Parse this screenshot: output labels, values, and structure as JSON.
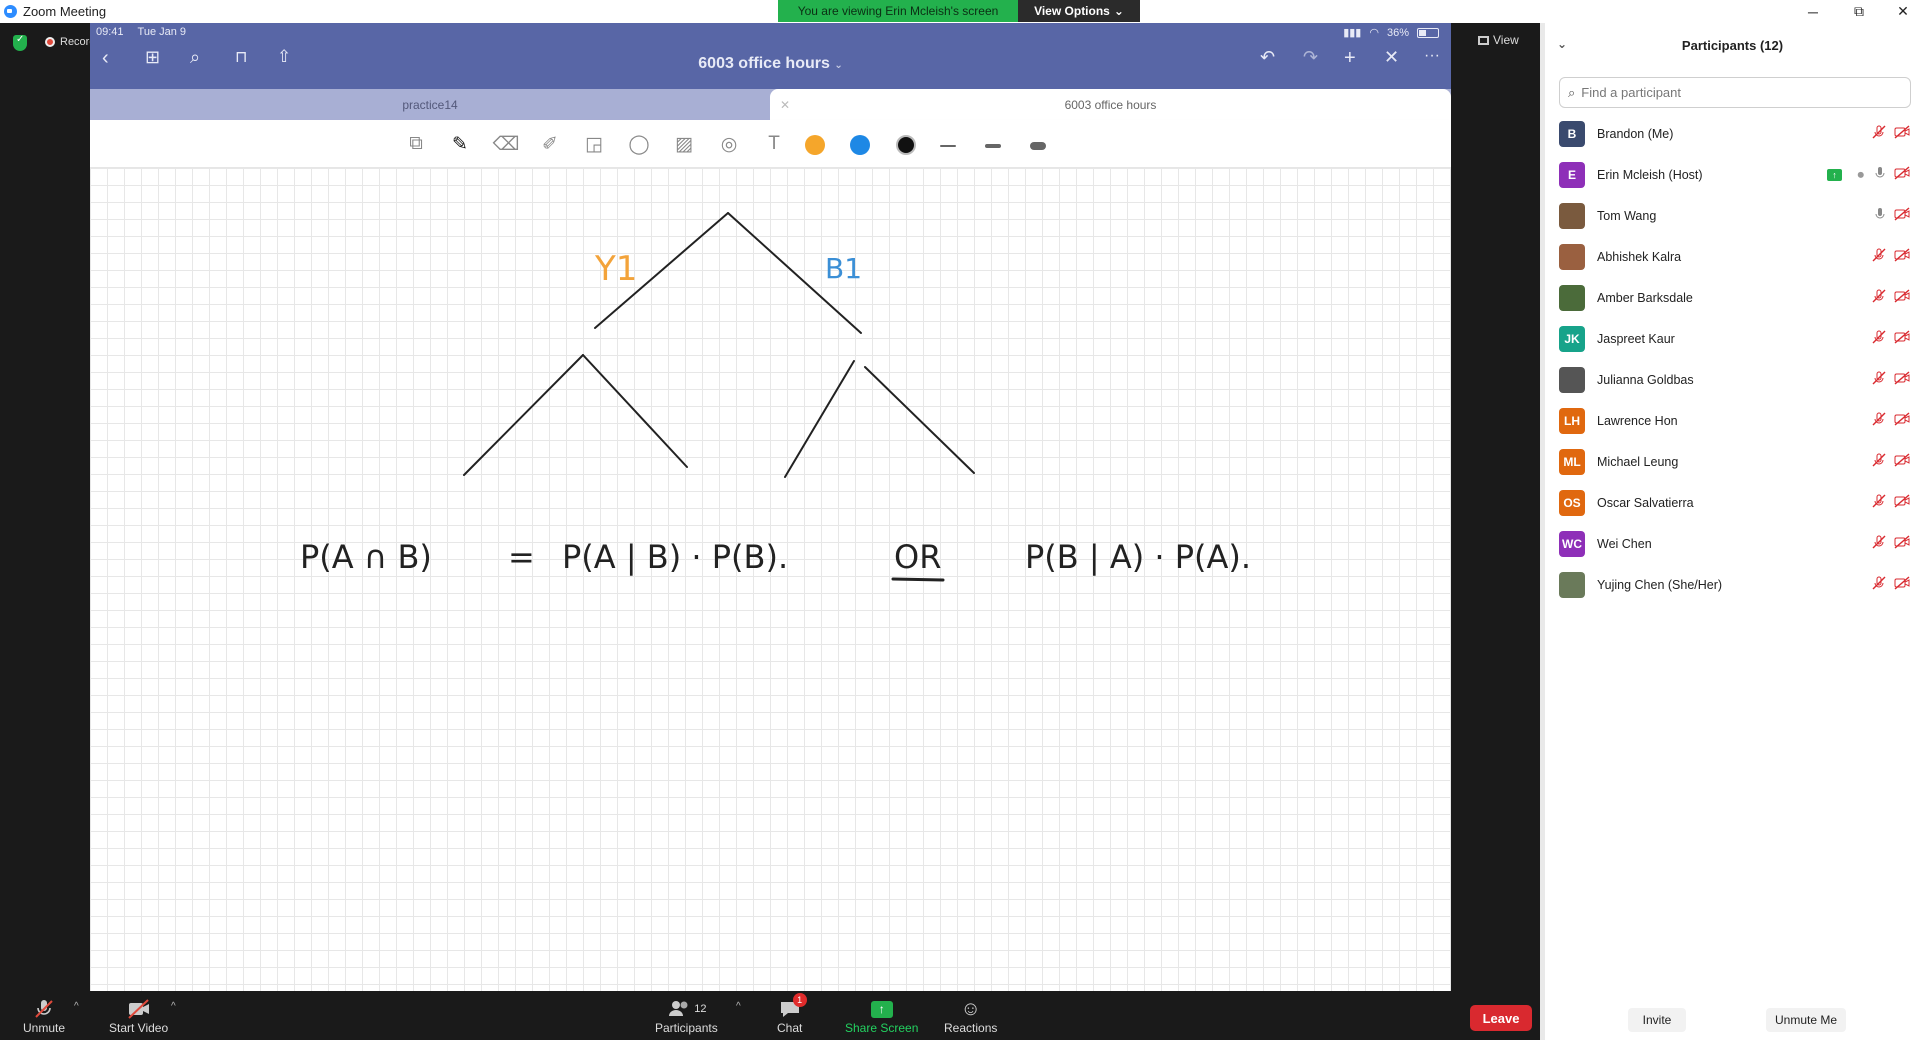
{
  "window": {
    "title": "Zoom Meeting",
    "min": "─",
    "max": "⧉",
    "close": "✕"
  },
  "banner": {
    "viewing": "You are viewing Erin Mcleish's screen",
    "view_options": "View Options",
    "caret": "⌄"
  },
  "meeting": {
    "recording": "Recording",
    "view": "View"
  },
  "ipad": {
    "time": "09:41",
    "date": "Tue Jan 9",
    "battery": "36%",
    "doc_title": "6003 office hours",
    "tabs": [
      {
        "label": "practice14"
      },
      {
        "label": "6003 office hours"
      }
    ],
    "colors": {
      "orange": "#f5a62b",
      "blue": "#1e88e5",
      "black": "#111111",
      "bar": "#5866a6"
    }
  },
  "drawing": {
    "branch_labels": {
      "left": "Y1",
      "right": "B1"
    },
    "formula": {
      "lhs": "P(A ∩ B)",
      "eq": "=",
      "rhs1": "P(A | B) · P(B).",
      "or": "OR",
      "rhs2": "P(B | A) · P(A)."
    },
    "colors": {
      "ink": "#222222",
      "left_label": "#f3a33a",
      "right_label": "#3b8fd6"
    }
  },
  "bottombar": {
    "unmute": "Unmute",
    "start_video": "Start Video",
    "participants": "Participants",
    "participants_count": "12",
    "chat": "Chat",
    "chat_badge": "1",
    "share_screen": "Share Screen",
    "reactions": "Reactions",
    "leave": "Leave"
  },
  "panel": {
    "title": "Participants (12)",
    "search_placeholder": "Find a participant",
    "participants": [
      {
        "initials": "B",
        "name": "Brandon (Me)",
        "color": "#3a4a6e",
        "mic": "off"
      },
      {
        "initials": "E",
        "name": "Erin Mcleish (Host)",
        "color": "#8e2fb8",
        "mic": "on",
        "sharing": true
      },
      {
        "initials": "",
        "name": "Tom Wang",
        "color": "#7a5a3e",
        "mic": "on",
        "photo": true
      },
      {
        "initials": "",
        "name": "Abhishek Kalra",
        "color": "#9a6040",
        "mic": "off",
        "photo": true
      },
      {
        "initials": "",
        "name": "Amber Barksdale",
        "color": "#4b6b3a",
        "mic": "off",
        "photo": true
      },
      {
        "initials": "JK",
        "name": "Jaspreet Kaur",
        "color": "#17a38a",
        "mic": "off"
      },
      {
        "initials": "",
        "name": "Julianna Goldbas",
        "color": "#555555",
        "mic": "off",
        "photo": true
      },
      {
        "initials": "LH",
        "name": "Lawrence Hon",
        "color": "#e0680f",
        "mic": "off"
      },
      {
        "initials": "ML",
        "name": "Michael Leung",
        "color": "#e0680f",
        "mic": "off"
      },
      {
        "initials": "OS",
        "name": "Oscar Salvatierra",
        "color": "#e0680f",
        "mic": "off"
      },
      {
        "initials": "WC",
        "name": "Wei Chen",
        "color": "#8e2fb8",
        "mic": "off"
      },
      {
        "initials": "",
        "name": "Yujing Chen (She/Her)",
        "color": "#6a7a5a",
        "mic": "off",
        "photo": true
      }
    ],
    "invite": "Invite",
    "unmute_me": "Unmute Me"
  }
}
